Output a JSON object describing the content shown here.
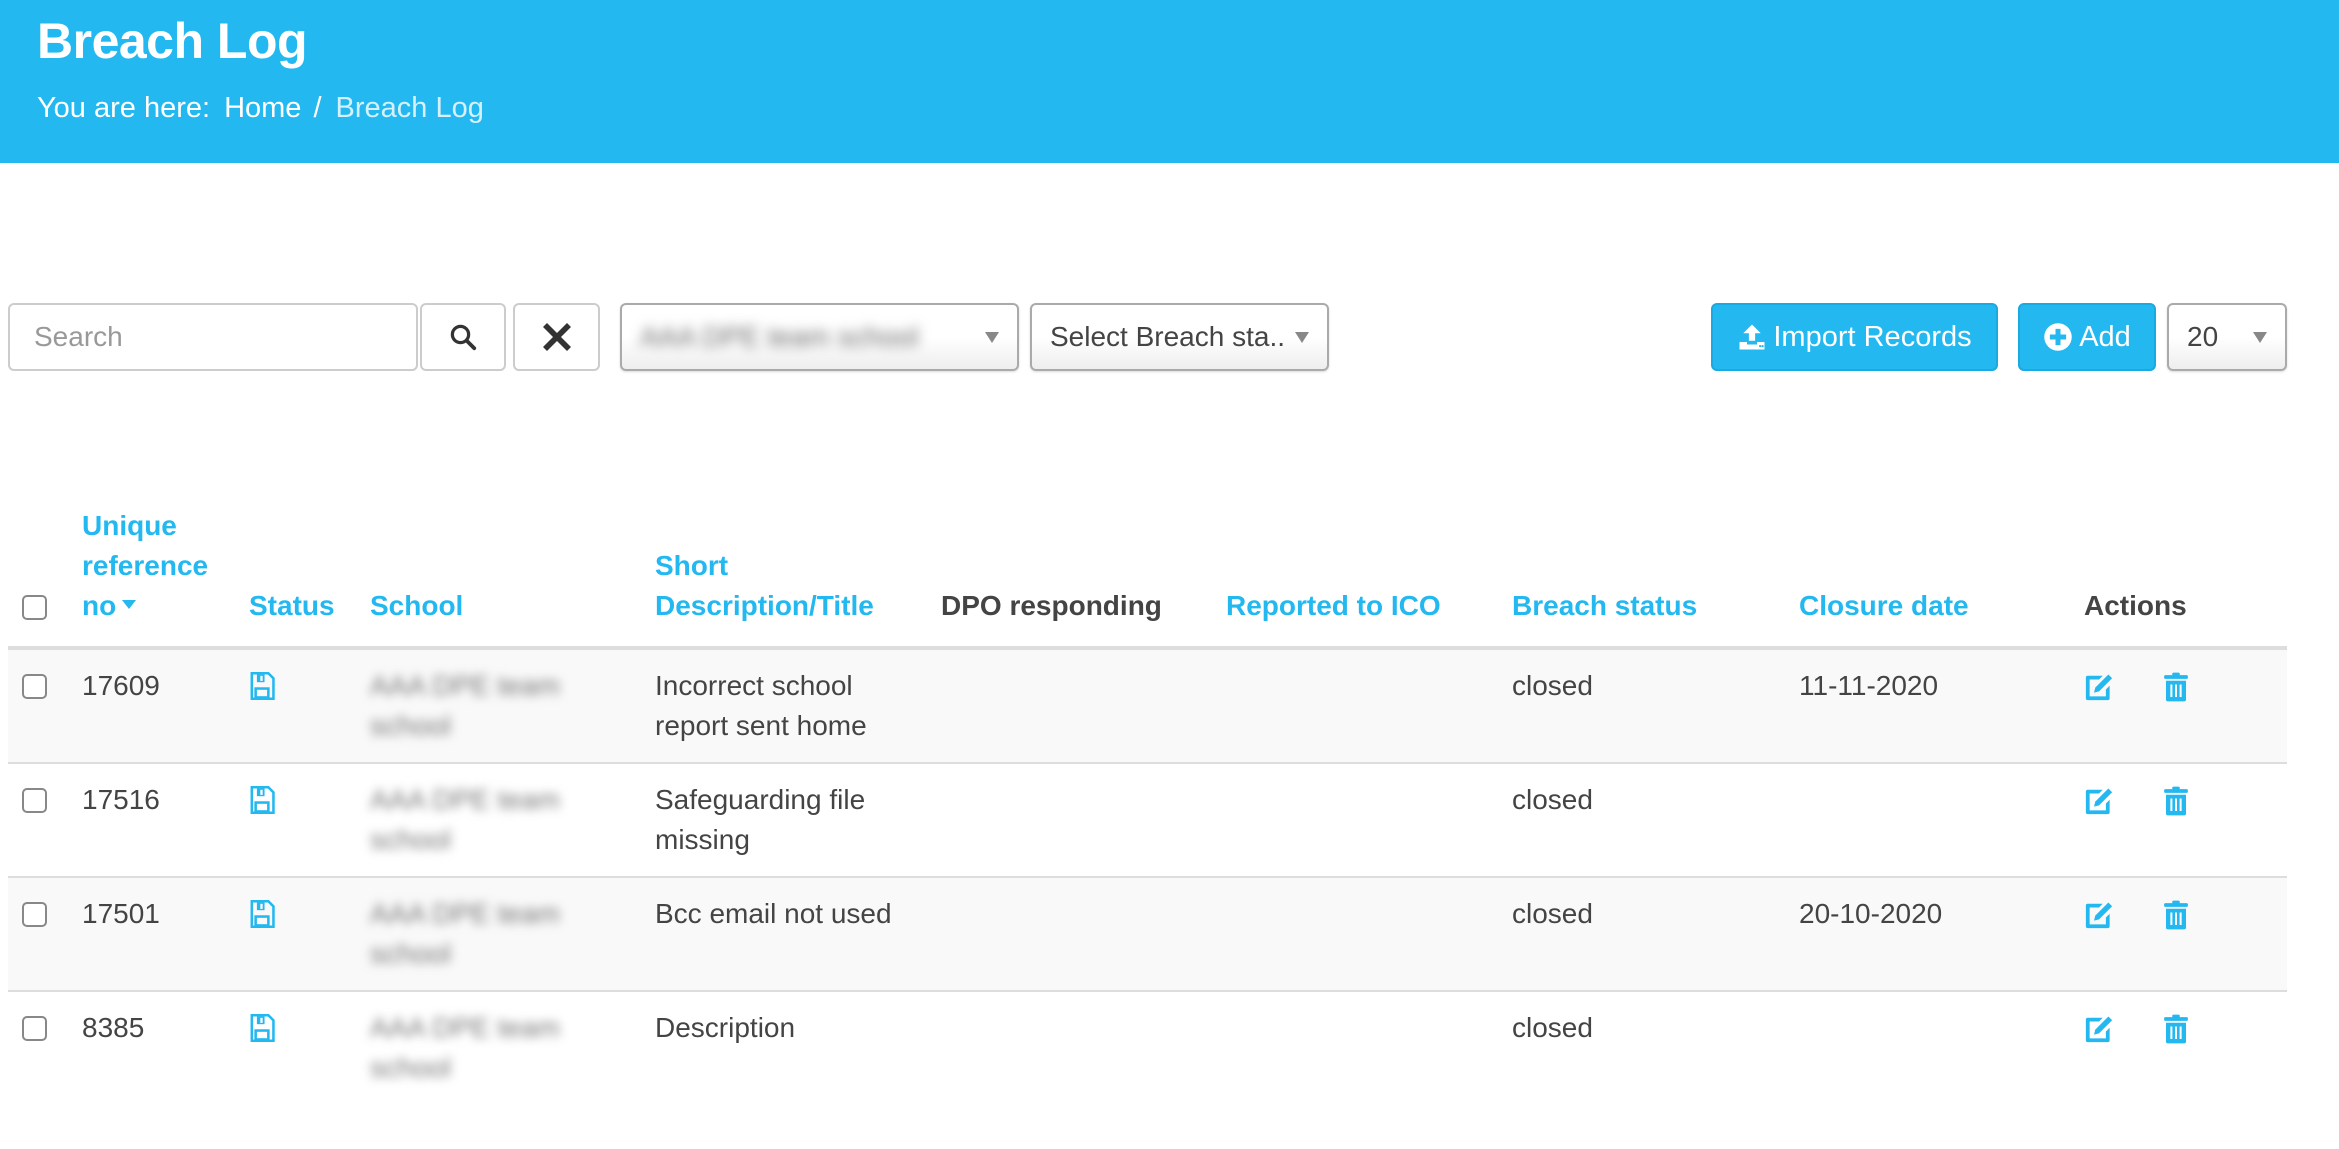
{
  "header": {
    "title": "Breach Log",
    "breadcrumb": {
      "prefix": "You are here:",
      "home": "Home",
      "separator": "/",
      "current": "Breach Log"
    }
  },
  "toolbar": {
    "search": {
      "placeholder": "Search",
      "value": ""
    },
    "search_button_icon": "search-icon",
    "clear_button_icon": "close-icon",
    "school_filter": {
      "selected": "AAA DPE team school",
      "redacted": true
    },
    "breach_status_filter": {
      "selected": "Select Breach sta..."
    },
    "import_button": {
      "label": "Import Records",
      "icon": "upload-icon"
    },
    "add_button": {
      "label": "Add",
      "icon": "plus-circle-icon"
    },
    "per_page": {
      "selected": "20"
    }
  },
  "table": {
    "columns": [
      {
        "key": "ref",
        "label": "Unique reference no",
        "sortable": true,
        "sorted": "desc"
      },
      {
        "key": "status",
        "label": "Status",
        "sortable": true
      },
      {
        "key": "school",
        "label": "School",
        "sortable": true
      },
      {
        "key": "desc",
        "label": "Short Description/Title",
        "sortable": true
      },
      {
        "key": "dpo",
        "label": "DPO responding",
        "sortable": false
      },
      {
        "key": "ico",
        "label": "Reported to ICO",
        "sortable": true
      },
      {
        "key": "breach",
        "label": "Breach status",
        "sortable": true
      },
      {
        "key": "closure",
        "label": "Closure date",
        "sortable": true
      },
      {
        "key": "actions",
        "label": "Actions",
        "sortable": false
      }
    ],
    "rows": [
      {
        "ref": "17609",
        "status_icon": "save-icon",
        "school": "AAA DPE team school",
        "desc": "Incorrect school report sent home",
        "dpo": "",
        "ico": "",
        "breach": "closed",
        "closure": "11-11-2020"
      },
      {
        "ref": "17516",
        "status_icon": "save-icon",
        "school": "AAA DPE team school",
        "desc": "Safeguarding file missing",
        "dpo": "",
        "ico": "",
        "breach": "closed",
        "closure": ""
      },
      {
        "ref": "17501",
        "status_icon": "save-icon",
        "school": "AAA DPE team school",
        "desc": "Bcc email not used",
        "dpo": "",
        "ico": "",
        "breach": "closed",
        "closure": "20-10-2020"
      },
      {
        "ref": "8385",
        "status_icon": "save-icon",
        "school": "AAA DPE team school",
        "desc": "Description",
        "dpo": "",
        "ico": "",
        "breach": "closed",
        "closure": ""
      }
    ]
  },
  "colors": {
    "accent": "#23b8f0",
    "header_text": "#ffffff",
    "body_text": "#444444",
    "row_stripe": "#f9f9f9",
    "border": "#dddddd"
  }
}
